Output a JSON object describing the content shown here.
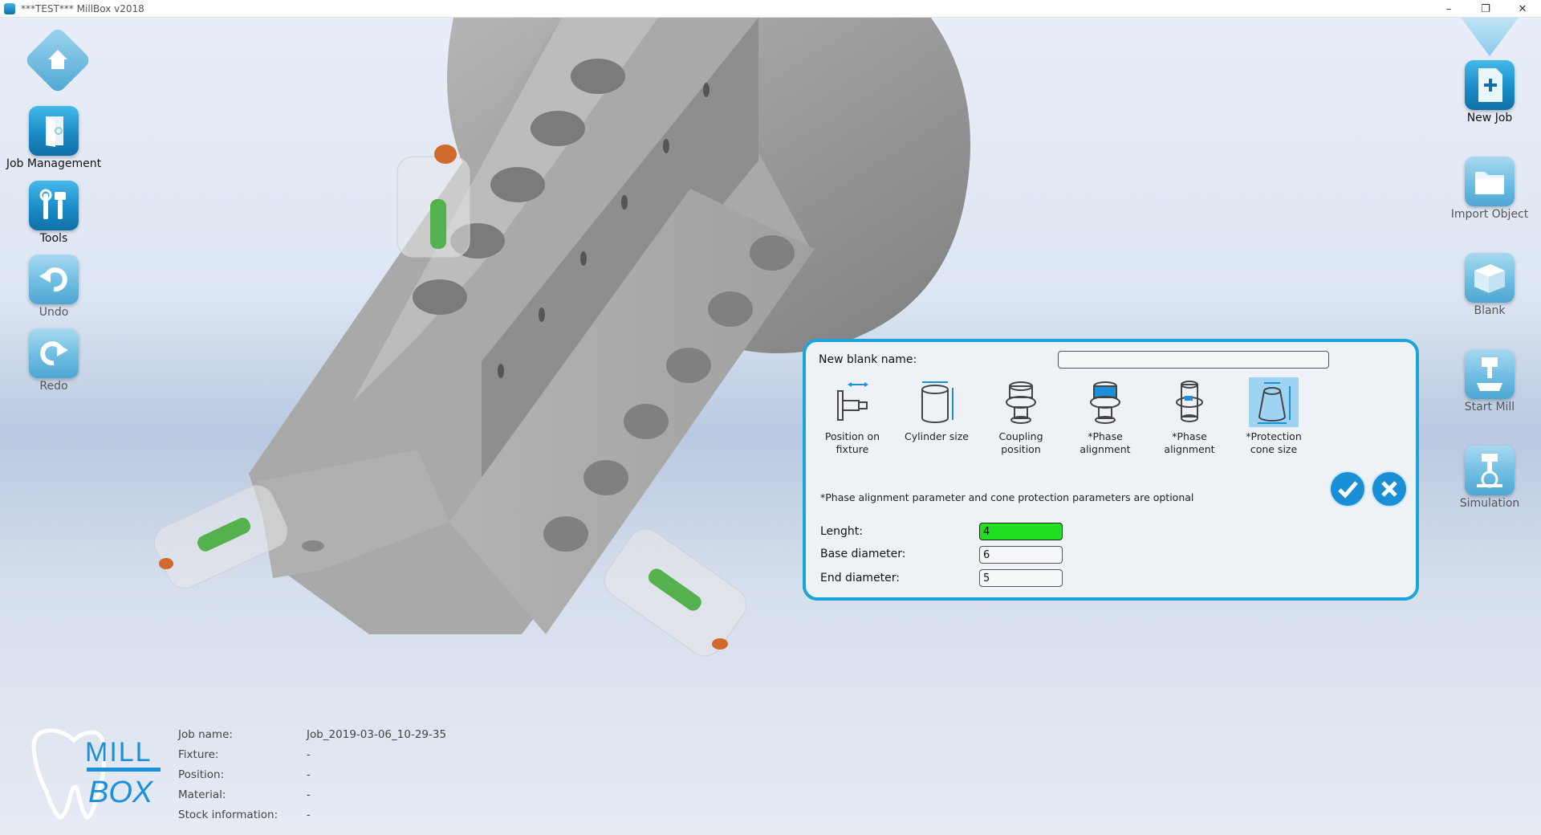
{
  "window": {
    "title": "***TEST*** MillBox v2018",
    "controls": {
      "minimize": "–",
      "restore": "❐",
      "close": "✕"
    }
  },
  "left_toolbar": {
    "home": {
      "icon": "home-icon"
    },
    "items": [
      {
        "label": "Job Management",
        "icon": "door-icon"
      },
      {
        "label": "Tools",
        "icon": "tools-icon"
      },
      {
        "label": "Undo",
        "icon": "undo-icon"
      },
      {
        "label": "Redo",
        "icon": "redo-icon"
      }
    ]
  },
  "right_toolbar": {
    "items": [
      {
        "label": "New Job",
        "icon": "new-file-icon"
      },
      {
        "label": "Import Object",
        "icon": "folder-icon"
      },
      {
        "label": "Blank",
        "icon": "blank-cube-icon"
      },
      {
        "label": "Start Mill",
        "icon": "mill-icon"
      },
      {
        "label": "Simulation",
        "icon": "simulation-icon"
      }
    ]
  },
  "dialog": {
    "new_blank_name_label": "New blank name:",
    "new_blank_name_value": "",
    "options": [
      {
        "line1": "Position on",
        "line2": "fixture",
        "selected": false
      },
      {
        "line1": "Cylinder size",
        "line2": "",
        "selected": false
      },
      {
        "line1": "Coupling",
        "line2": "position",
        "selected": false
      },
      {
        "line1": "*Phase",
        "line2": "alignment",
        "selected": false
      },
      {
        "line1": "*Phase",
        "line2": "alignment",
        "selected": false
      },
      {
        "line1": "*Protection",
        "line2": "cone size",
        "selected": true
      }
    ],
    "note": "*Phase alignment parameter and cone protection parameters are optional",
    "fields": [
      {
        "label": "Lenght:",
        "value": "4"
      },
      {
        "label": "Base diameter:",
        "value": "6"
      },
      {
        "label": "End diameter:",
        "value": "5"
      }
    ],
    "confirm_icon": "checkmark-icon",
    "cancel_icon": "close-icon"
  },
  "info": {
    "rows": [
      {
        "label": "Job name:",
        "value": "Job_2019-03-06_10-29-35"
      },
      {
        "label": "Fixture:",
        "value": "-"
      },
      {
        "label": "Position:",
        "value": "-"
      },
      {
        "label": "Material:",
        "value": "-"
      },
      {
        "label": "Stock information:",
        "value": "-"
      }
    ]
  },
  "logo": {
    "line1": "MILL",
    "line2": "BOX"
  },
  "colors": {
    "accent": "#1ba4dc",
    "tile_blue": "#1a8cc8",
    "active_field": "#21e021",
    "fixture_gray": "#9a9a9a"
  }
}
